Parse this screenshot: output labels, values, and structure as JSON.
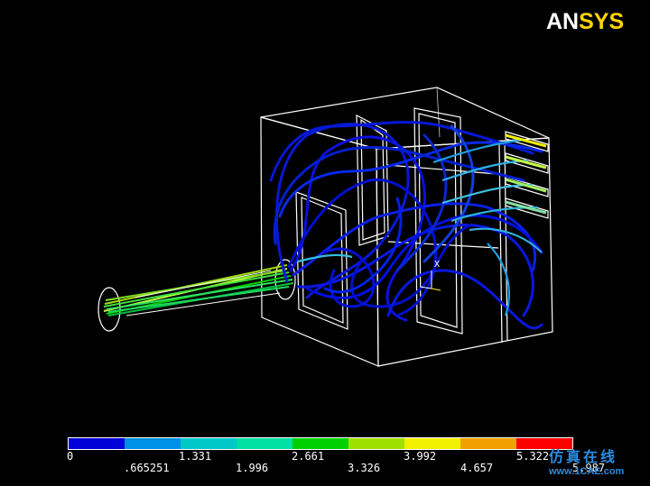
{
  "logo": {
    "part_a": "AN",
    "part_b": "SYS"
  },
  "legend": {
    "colors": [
      "#0000d8",
      "#0090e8",
      "#00c8c8",
      "#00e0a0",
      "#00d000",
      "#a0e000",
      "#f0f000",
      "#f0a000",
      "#ff0000"
    ],
    "upper_labels": [
      "0",
      "1.331",
      "2.661",
      "3.992",
      "5.322"
    ],
    "lower_labels": [
      ".665251",
      "1.996",
      "3.326",
      "4.657",
      "5.987"
    ]
  },
  "watermark": {
    "text": "仿真在线",
    "url": "www.1CAE.com"
  },
  "axis_label": "X"
}
